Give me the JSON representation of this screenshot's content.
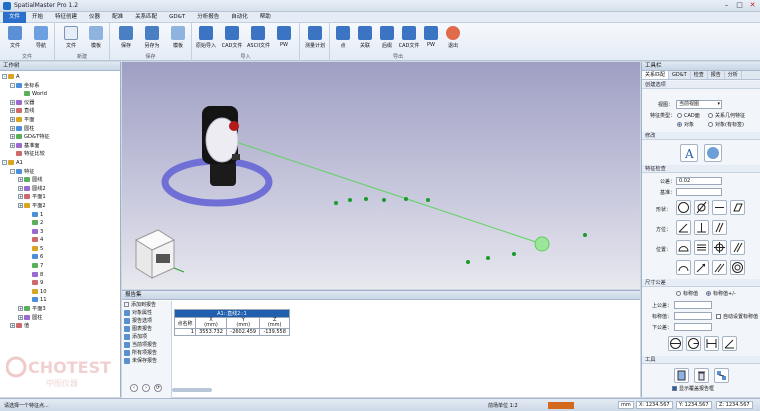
{
  "window": {
    "title": "SpatialMaster Pro 1.2"
  },
  "menu": [
    "文件",
    "开始",
    "特征创建",
    "仪器",
    "配准",
    "关系匹配",
    "GD&T",
    "分析报告",
    "自动化",
    "帮助"
  ],
  "ribbon": {
    "groups": [
      {
        "label": "文件",
        "buttons": [
          "文件",
          "导航"
        ]
      },
      {
        "label": "新建",
        "buttons": [
          "文件",
          "模板"
        ]
      },
      {
        "label": "保存",
        "buttons": [
          "保存",
          "另存为",
          "模板"
        ]
      },
      {
        "label": "导入",
        "buttons": [
          "原始导入",
          "CAD文件",
          "ASCII文件",
          "PW"
        ]
      },
      {
        "label": "",
        "buttons": [
          "测量计划"
        ]
      },
      {
        "label": "导出",
        "buttons": [
          "点",
          "关联",
          "后缀",
          "CAD文件",
          "PW",
          "退出"
        ]
      }
    ]
  },
  "left_panel": {
    "header": "工作树",
    "tree": [
      {
        "label": "A",
        "depth": 0,
        "expander": "-"
      },
      {
        "label": "坐标系",
        "depth": 1,
        "expander": "-"
      },
      {
        "label": "World",
        "depth": 2,
        "expander": ""
      },
      {
        "label": "仪器",
        "depth": 1,
        "expander": "+"
      },
      {
        "label": "直线",
        "depth": 1,
        "expander": "+"
      },
      {
        "label": "平面",
        "depth": 1,
        "expander": "+"
      },
      {
        "label": "圆柱",
        "depth": 1,
        "expander": "+"
      },
      {
        "label": "GD&T特征",
        "depth": 1,
        "expander": "+"
      },
      {
        "label": "基准面",
        "depth": 1,
        "expander": "+"
      },
      {
        "label": "特征比较",
        "depth": 1,
        "expander": ""
      },
      {
        "label": "A1",
        "depth": 0,
        "expander": "-"
      },
      {
        "label": "特征",
        "depth": 1,
        "expander": "-"
      },
      {
        "label": "圆线",
        "depth": 2,
        "expander": "+"
      },
      {
        "label": "圆线2",
        "depth": 2,
        "expander": "+"
      },
      {
        "label": "平面1",
        "depth": 2,
        "expander": "+"
      },
      {
        "label": "平面2",
        "depth": 2,
        "expander": "+"
      },
      {
        "label": "1",
        "depth": 3,
        "expander": ""
      },
      {
        "label": "2",
        "depth": 3,
        "expander": ""
      },
      {
        "label": "3",
        "depth": 3,
        "expander": ""
      },
      {
        "label": "4",
        "depth": 3,
        "expander": ""
      },
      {
        "label": "5",
        "depth": 3,
        "expander": ""
      },
      {
        "label": "6",
        "depth": 3,
        "expander": ""
      },
      {
        "label": "7",
        "depth": 3,
        "expander": ""
      },
      {
        "label": "8",
        "depth": 3,
        "expander": ""
      },
      {
        "label": "9",
        "depth": 3,
        "expander": ""
      },
      {
        "label": "10",
        "depth": 3,
        "expander": ""
      },
      {
        "label": "11",
        "depth": 3,
        "expander": ""
      },
      {
        "label": "平面3",
        "depth": 2,
        "expander": "+"
      },
      {
        "label": "圆柱",
        "depth": 2,
        "expander": "+"
      },
      {
        "label": "值",
        "depth": 1,
        "expander": "+"
      }
    ],
    "watermark": "CHOTEST",
    "watermark_sub": "中图仪器"
  },
  "report": {
    "header": "报告集",
    "options": [
      "添加到报告",
      "对象属性",
      "报告选项",
      "图表报告",
      "添加项",
      "当前项报告",
      "所有项报告",
      "未保存报告"
    ],
    "table_title": "A1::直线2::1",
    "col_headers": [
      "点名称",
      "X\n(mm)",
      "Y\n(mm)",
      "Z\n(mm)"
    ],
    "row": [
      "1",
      "3553.732",
      "-2602.459",
      "-139.558"
    ]
  },
  "right_panel": {
    "header": "工具栏",
    "tabs": [
      "关系匹配",
      "GD&T",
      "检查",
      "报告",
      "分析"
    ],
    "create_section": "创建选项",
    "view_label": "视图：",
    "view_value": "当前视图",
    "feature_type_label": "特征类型：",
    "radio_cad": "CAD面",
    "radio_relation": "关系几何特征",
    "radio_object": "对象",
    "radio_object2": "对象(有标签)",
    "tools_section": "修改",
    "feature_section": "特征检查",
    "tol_label": "公差：",
    "tol_value": "0.02",
    "base_label": "基准：",
    "shape_label": "形状：",
    "direction_label": "方位：",
    "position_label": "位置：",
    "size_section": "尺寸公差",
    "size_radio_a": "标称值",
    "size_radio_b": "标称值+/-",
    "upper_label": "上公差：",
    "nominal_label": "标称值：",
    "lower_label": "下公差：",
    "auto_nominal": "自动设置标称值",
    "misc_section": "工具",
    "show_tool_bar": "显示覆盖报告框"
  },
  "status": {
    "message": "请选择一个特征点...",
    "center": "前场单位 1:2",
    "unit": "mm",
    "x": "X: 1234.567",
    "y": "Y: 1234.567",
    "z": "Z: 1234.567"
  }
}
